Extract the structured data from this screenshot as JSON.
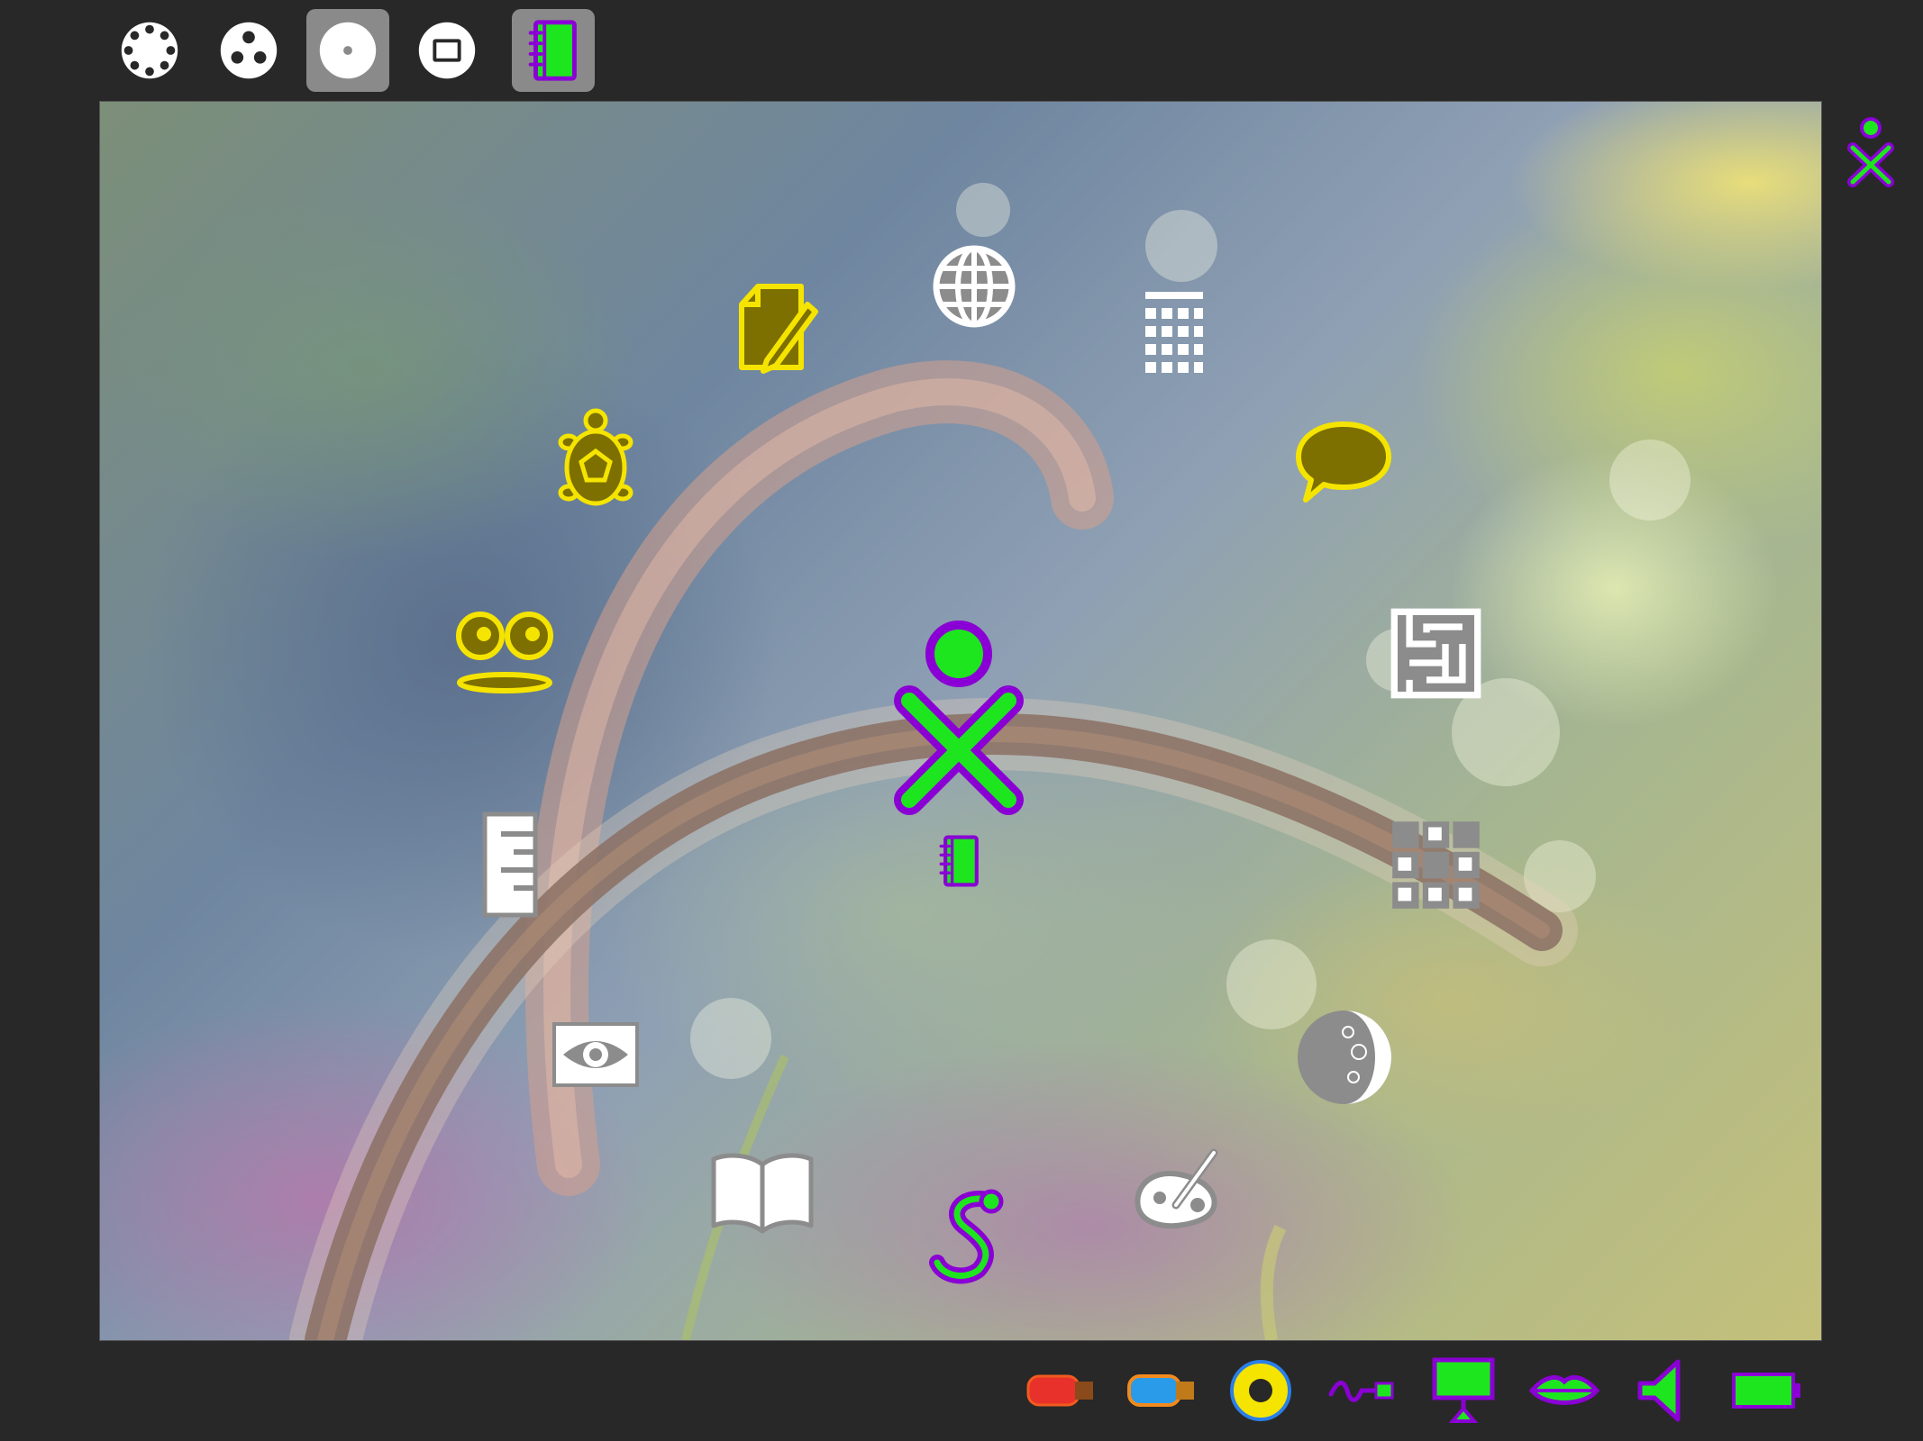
{
  "toolbar": {
    "views": [
      {
        "icon": "neighborhood-view-icon",
        "active": false
      },
      {
        "icon": "group-view-icon",
        "active": false
      },
      {
        "icon": "home-view-icon",
        "active": true
      },
      {
        "icon": "activity-view-icon",
        "active": false
      },
      {
        "icon": "journal-icon",
        "active": true
      }
    ]
  },
  "colors": {
    "xo_stroke": "#8a00d4",
    "xo_fill": "#1ee61e",
    "yellow": "#f5e400",
    "olive": "#7d7000",
    "gray_icon": "#8c8c8c",
    "white_icon": "#ffffff",
    "background": "#282828"
  },
  "home_ring": {
    "center_icon": "xo-buddy-icon",
    "below_center_icon": "journal-icon",
    "activities": [
      "write-activity-icon",
      "browse-activity-icon",
      "calculate-activity-icon",
      "turtle-art-activity-icon",
      "chat-activity-icon",
      "record-activity-icon",
      "maze-activity-icon",
      "measure-activity-icon",
      "memorize-activity-icon",
      "imageviewer-activity-icon",
      "moon-activity-icon",
      "read-activity-icon",
      "pippy-activity-icon",
      "paint-activity-icon"
    ]
  },
  "frame": {
    "side_icon": "xo-owner-icon"
  },
  "tray": {
    "devices": [
      "usb-drive-red-icon",
      "usb-drive-blue-icon",
      "optical-disc-icon",
      "network-wire-icon",
      "display-icon",
      "speech-icon",
      "speaker-volume-icon",
      "battery-icon"
    ]
  }
}
